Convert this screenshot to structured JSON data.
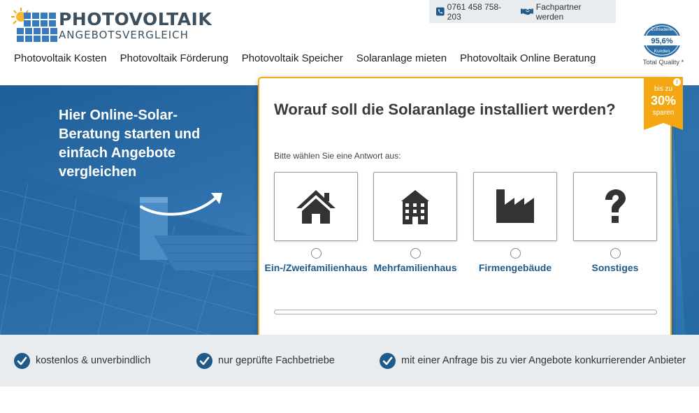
{
  "header": {
    "logo_title": "PHOTOVOLTAIK",
    "logo_subtitle": "ANGEBOTSVERGLEICH",
    "phone": "0761 458 758-203",
    "partner_link": "Fachpartner werden"
  },
  "nav": {
    "items": [
      "Photovoltaik Kosten",
      "Photovoltaik Förderung",
      "Photovoltaik Speicher",
      "Solaranlage mieten",
      "Photovoltaik Online Beratung"
    ]
  },
  "badge": {
    "top_text": "Zufriedene",
    "value": "95,6%",
    "bottom_text": "Kunden",
    "label": "Total Quality *"
  },
  "hero": {
    "title": "Hier Online-Solar-Beratung starten und einfach Angebote vergleichen"
  },
  "ribbon": {
    "line1": "bis zu",
    "line2": "30%",
    "line3": "sparen",
    "info": "i"
  },
  "form": {
    "question": "Worauf soll die Solaranlage installiert werden?",
    "hint": "Bitte wählen Sie eine Antwort aus:",
    "options": [
      {
        "label": "Ein-/Zweifamilienhaus",
        "icon": "house-icon"
      },
      {
        "label": "Mehrfamilienhaus",
        "icon": "apartment-building-icon"
      },
      {
        "label": "Firmengebäude",
        "icon": "factory-icon"
      },
      {
        "label": "Sonstiges",
        "icon": "question-mark-icon"
      }
    ],
    "progress": 0
  },
  "features": [
    "kostenlos & unverbindlich",
    "nur geprüfte Fachbetriebe",
    "mit einer Anfrage bis zu vier Angebote konkurrierender Anbieter"
  ],
  "colors": {
    "accent": "#f3a712",
    "brand_blue": "#1e5a8a",
    "hero_blue": "#2d6fab",
    "text_dark": "#3a3a3a"
  }
}
